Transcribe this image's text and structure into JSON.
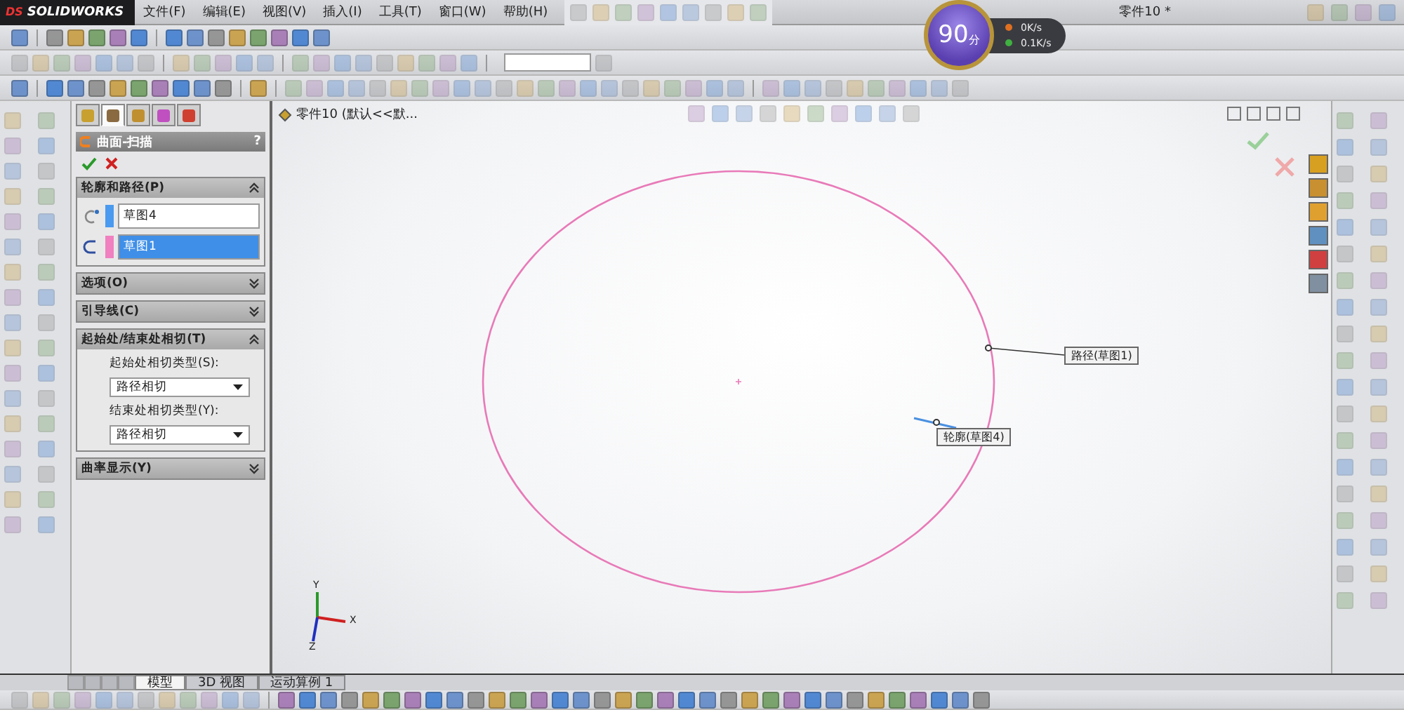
{
  "app": {
    "brand_mark": "DS",
    "brand": "SOLIDWORKS"
  },
  "menu": [
    {
      "label": "文件(F)"
    },
    {
      "label": "编辑(E)"
    },
    {
      "label": "视图(V)"
    },
    {
      "label": "插入(I)"
    },
    {
      "label": "工具(T)"
    },
    {
      "label": "窗口(W)"
    },
    {
      "label": "帮助(H)"
    }
  ],
  "document_title": "零件10 *",
  "speed_widget": {
    "score": "90",
    "unit": "分",
    "upload": "0K/s",
    "download": "0.1K/s"
  },
  "panel_tabs": [
    {
      "selected": false
    },
    {
      "selected": true
    },
    {
      "selected": false
    },
    {
      "selected": false
    },
    {
      "selected": false
    }
  ],
  "property_manager": {
    "title": "曲面-扫描",
    "help": "?",
    "sections": [
      {
        "kind": "selections",
        "title": "轮廓和路径(P)",
        "expanded": true,
        "items": [
          {
            "kind": "profile",
            "text": "草图4",
            "color": "#4a9af0",
            "selected": false
          },
          {
            "kind": "path",
            "text": "草图1",
            "color": "#f080c0",
            "selected": true
          }
        ]
      },
      {
        "title": "选项(O)",
        "expanded": false
      },
      {
        "title": "引导线(C)",
        "expanded": false
      },
      {
        "kind": "dropdowns",
        "title": "起始处/结束处相切(T)",
        "expanded": true,
        "fields": [
          {
            "label": "起始处相切类型(S):",
            "value": "路径相切"
          },
          {
            "label": "结束处相切类型(Y):",
            "value": "路径相切"
          }
        ]
      },
      {
        "title": "曲率显示(Y)",
        "expanded": false
      }
    ]
  },
  "feature_tree": {
    "label": "零件10  (默认<<默..."
  },
  "canvas": {
    "callouts": [
      {
        "kind": "path",
        "text": "路径(草图1)"
      },
      {
        "kind": "profile",
        "text": "轮廓(草图4)"
      }
    ],
    "triad": [
      "Y",
      "X",
      "Z"
    ]
  },
  "bottom_tabs": [
    {
      "label": "模型",
      "selected": true
    },
    {
      "label": "3D 视图",
      "selected": false
    },
    {
      "label": "运动算例 1",
      "selected": false
    }
  ]
}
